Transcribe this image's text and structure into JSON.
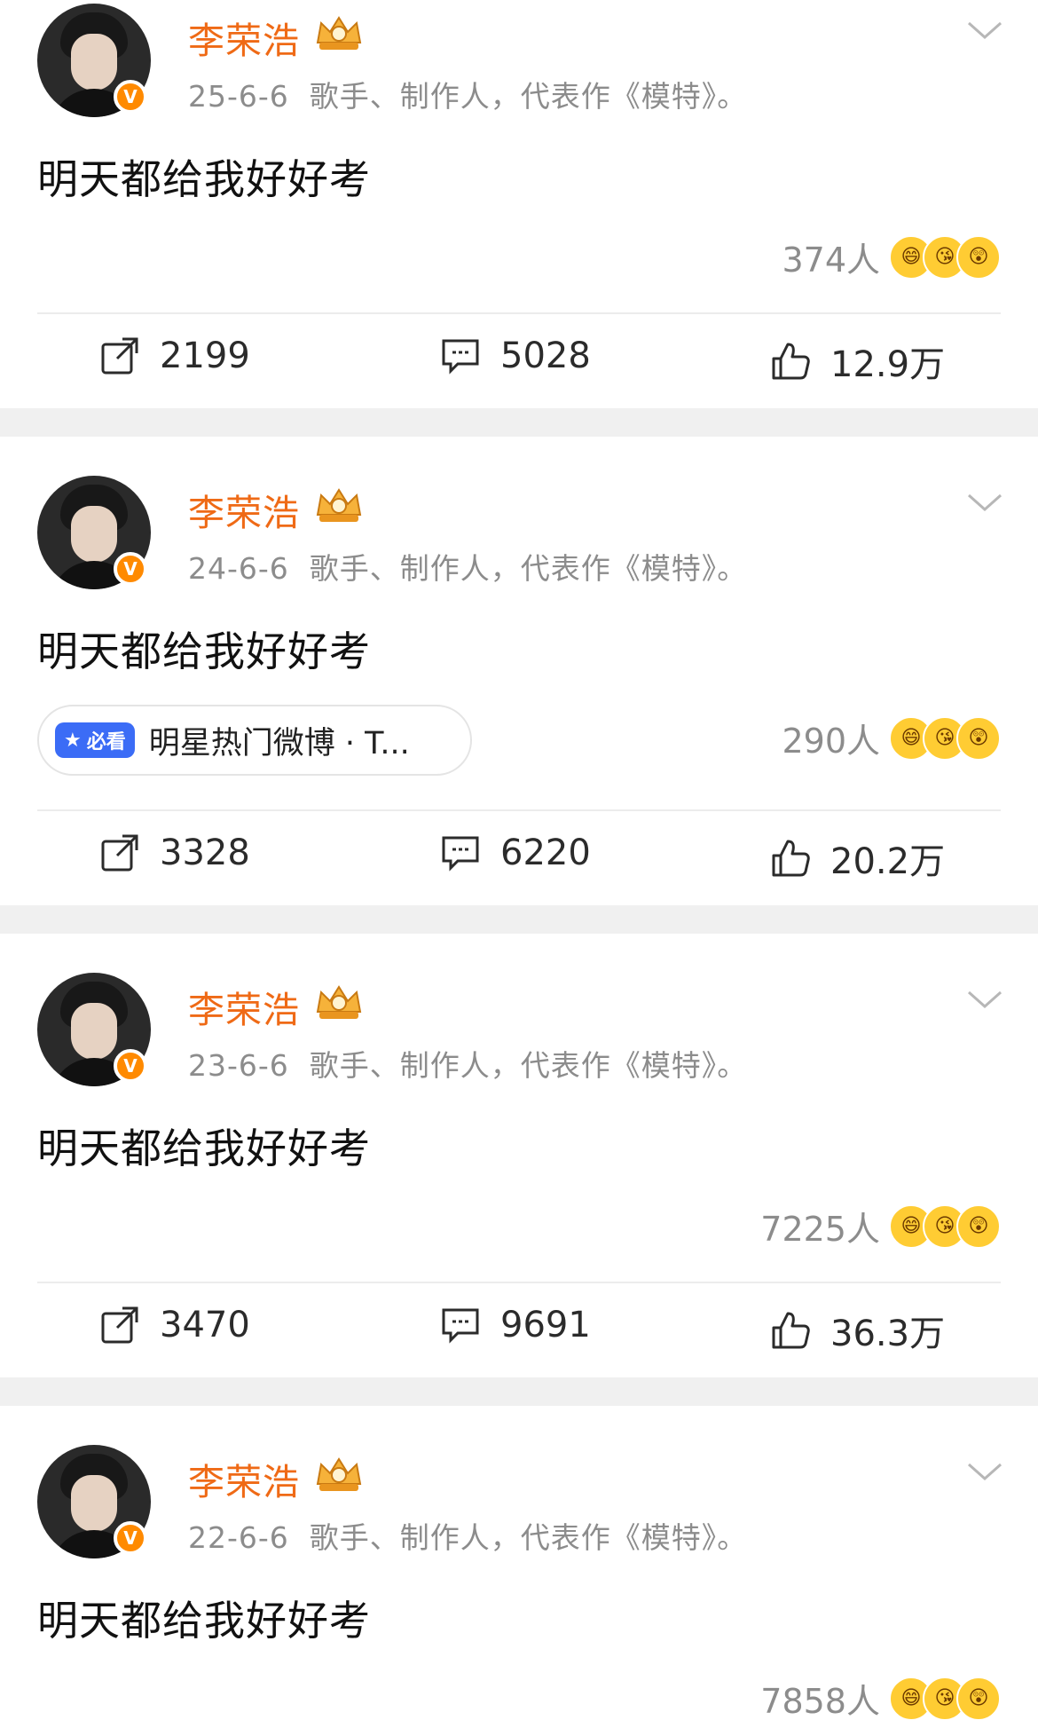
{
  "posts": [
    {
      "name": "李荣浩",
      "date": "25-6-6",
      "bio": "歌手、制作人，代表作《模特》。",
      "text": "明天都给我好好考",
      "reactions_count": "374人",
      "shares": "2199",
      "comments": "5028",
      "likes": "12.9万",
      "tag": null
    },
    {
      "name": "李荣浩",
      "date": "24-6-6",
      "bio": "歌手、制作人，代表作《模特》。",
      "text": "明天都给我好好考",
      "reactions_count": "290人",
      "shares": "3328",
      "comments": "6220",
      "likes": "20.2万",
      "tag": {
        "badge": "必看",
        "text": "明星热门微博 · T..."
      }
    },
    {
      "name": "李荣浩",
      "date": "23-6-6",
      "bio": "歌手、制作人，代表作《模特》。",
      "text": "明天都给我好好考",
      "reactions_count": "7225人",
      "shares": "3470",
      "comments": "9691",
      "likes": "36.3万",
      "tag": null
    },
    {
      "name": "李荣浩",
      "date": "22-6-6",
      "bio": "歌手、制作人，代表作《模特》。",
      "text": "明天都给我好好考",
      "reactions_count": "7858人",
      "tag": null
    }
  ],
  "colors": {
    "name": "#ef6a16",
    "verified": "#ff8a00",
    "tag_badge": "#3b6cf6"
  },
  "icons": {
    "share": "share-icon",
    "comment": "comment-icon",
    "like": "like-icon",
    "chevron": "chevron-down-icon",
    "crown": "crown-icon"
  }
}
